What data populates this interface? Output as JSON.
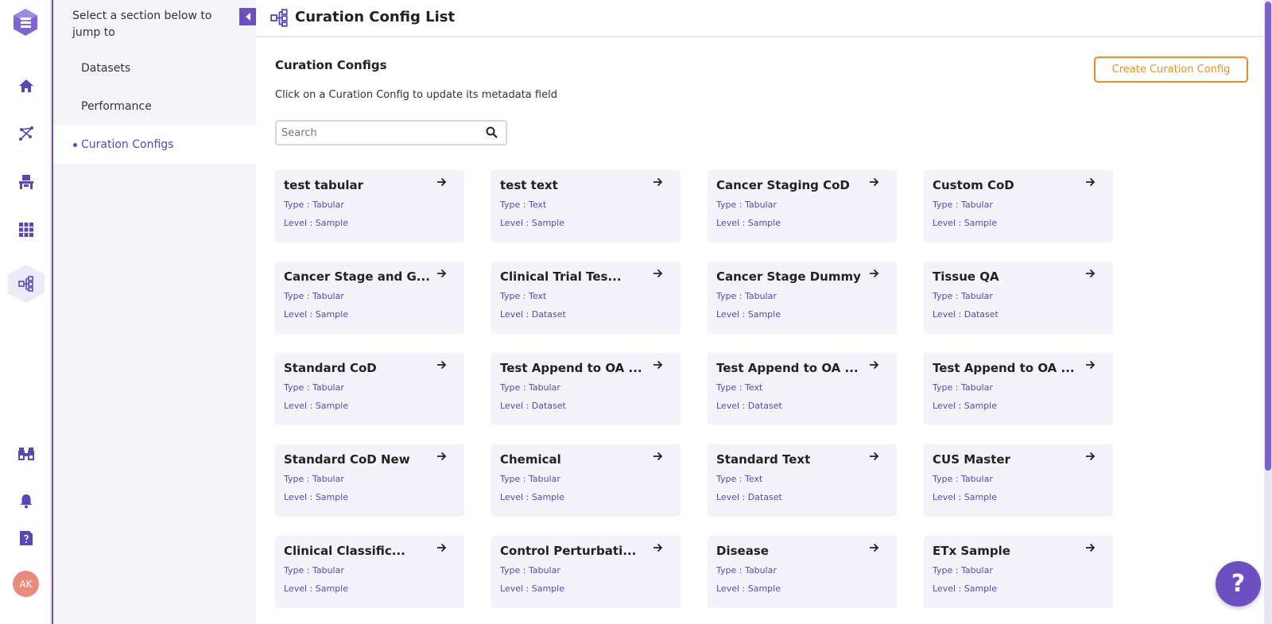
{
  "colors": {
    "accent": "#6c4fc0",
    "orange": "#e8901f",
    "card_bg": "#f4f3f9",
    "meta_text": "#5b46b8"
  },
  "rail": {
    "icons": [
      "app-logo",
      "home-icon",
      "graph-nodes-icon",
      "workbench-icon",
      "apps-grid-icon",
      "curation-config-icon",
      "binoculars-icon",
      "bell-icon",
      "help-doc-icon"
    ],
    "avatar_initials": "AK"
  },
  "secnav": {
    "hint": "Select a section below to jump to",
    "items": [
      {
        "label": "Datasets"
      },
      {
        "label": "Performance"
      },
      {
        "label": "Curation Configs"
      }
    ]
  },
  "header": {
    "title": "Curation Config List"
  },
  "main": {
    "section_title": "Curation Configs",
    "subtitle": "Click on a Curation Config to update its metadata field",
    "create_button": "Create Curation Config",
    "search_placeholder": "Search"
  },
  "cards": [
    {
      "name": "test tabular",
      "type": "Type : Tabular",
      "level": "Level : Sample"
    },
    {
      "name": "test text",
      "type": "Type : Text",
      "level": "Level : Sample"
    },
    {
      "name": "Cancer Staging CoD",
      "type": "Type : Tabular",
      "level": "Level : Sample"
    },
    {
      "name": "Custom CoD",
      "type": "Type : Tabular",
      "level": "Level : Sample"
    },
    {
      "name": "Cancer Stage and G...",
      "type": "Type : Tabular",
      "level": "Level : Sample"
    },
    {
      "name": "Clinical Trial Tes...",
      "type": "Type : Text",
      "level": "Level : Dataset"
    },
    {
      "name": "Cancer Stage Dummy",
      "type": "Type : Tabular",
      "level": "Level : Sample"
    },
    {
      "name": "Tissue QA",
      "type": "Type : Tabular",
      "level": "Level : Dataset"
    },
    {
      "name": "Standard CoD",
      "type": "Type : Tabular",
      "level": "Level : Sample"
    },
    {
      "name": "Test Append to OA ...",
      "type": "Type : Tabular",
      "level": "Level : Dataset"
    },
    {
      "name": "Test Append to OA ...",
      "type": "Type : Text",
      "level": "Level : Dataset"
    },
    {
      "name": "Test Append to OA ...",
      "type": "Type : Tabular",
      "level": "Level : Sample"
    },
    {
      "name": "Standard CoD New",
      "type": "Type : Tabular",
      "level": "Level : Sample"
    },
    {
      "name": "Chemical",
      "type": "Type : Tabular",
      "level": "Level : Sample"
    },
    {
      "name": "Standard Text",
      "type": "Type : Text",
      "level": "Level : Dataset"
    },
    {
      "name": "CUS Master",
      "type": "Type : Tabular",
      "level": "Level : Sample"
    },
    {
      "name": "Clinical Classific...",
      "type": "Type : Tabular",
      "level": "Level : Sample"
    },
    {
      "name": "Control Perturbati...",
      "type": "Type : Tabular",
      "level": "Level : Sample"
    },
    {
      "name": "Disease",
      "type": "Type : Tabular",
      "level": "Level : Sample"
    },
    {
      "name": "ETx Sample",
      "type": "Type : Tabular",
      "level": "Level : Sample"
    }
  ],
  "help": {
    "label": "?"
  }
}
